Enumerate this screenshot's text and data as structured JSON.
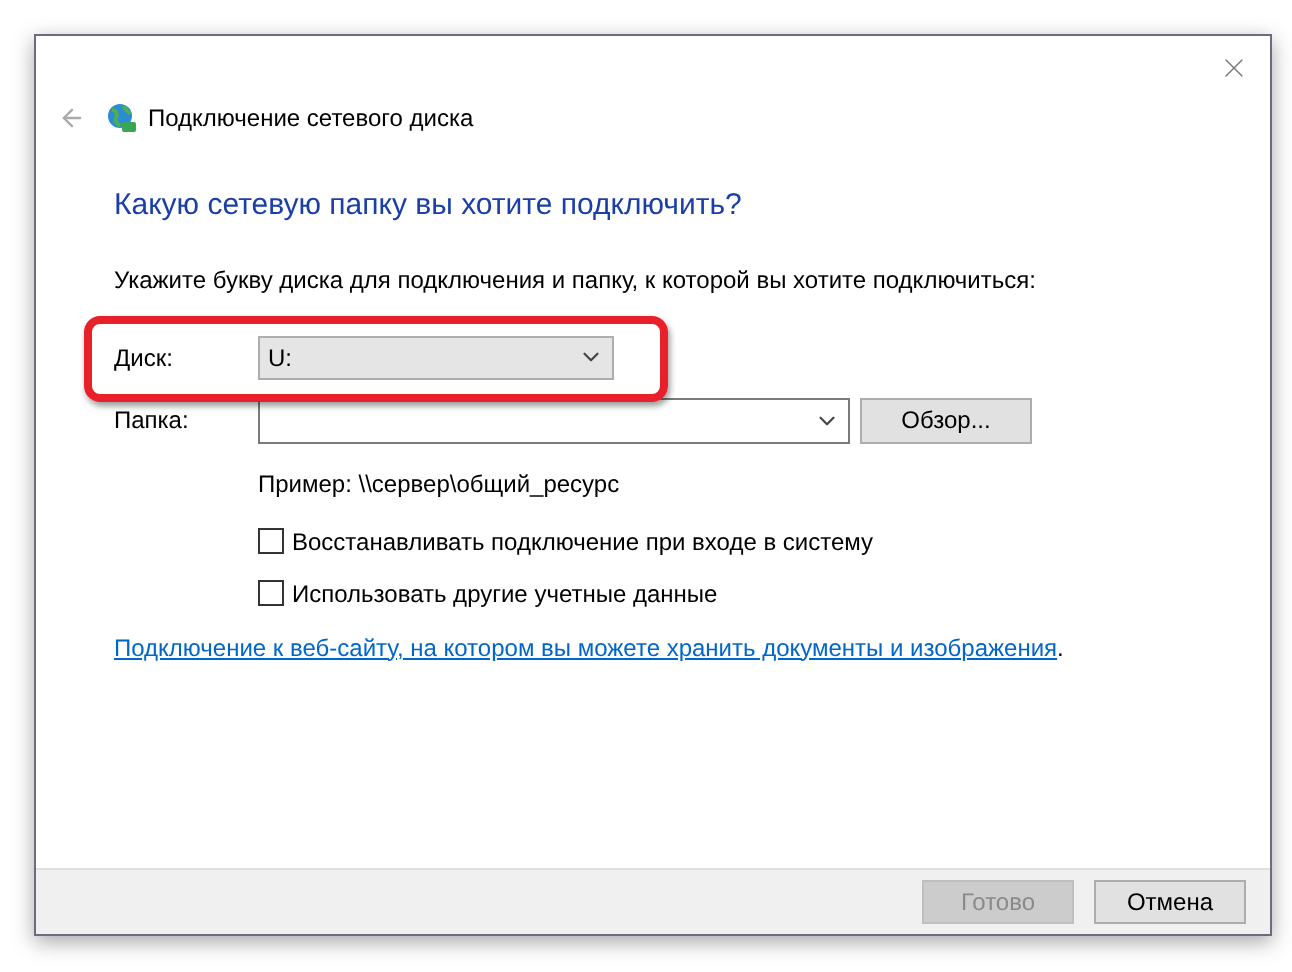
{
  "window": {
    "title": "Подключение сетевого диска"
  },
  "heading": "Какую сетевую папку вы хотите подключить?",
  "instruction": "Укажите букву диска для подключения и папку, к которой вы хотите подключиться:",
  "drive": {
    "label": "Диск:",
    "value": "U:",
    "highlighted": true
  },
  "folder": {
    "label": "Папка:"
  },
  "browse_button": "Обзор...",
  "example": "Пример: \\\\сервер\\общий_ресурс",
  "checkboxes": [
    {
      "label": "Восстанавливать подключение при входе в систему",
      "checked": false
    },
    {
      "label": "Использовать другие учетные данные",
      "checked": false
    }
  ],
  "link": {
    "text": "Подключение к веб-сайту, на котором вы можете хранить документы и изображения",
    "suffix": "."
  },
  "buttons": [
    {
      "label": "Готово",
      "disabled": true
    },
    {
      "label": "Отмена",
      "disabled": false
    }
  ]
}
